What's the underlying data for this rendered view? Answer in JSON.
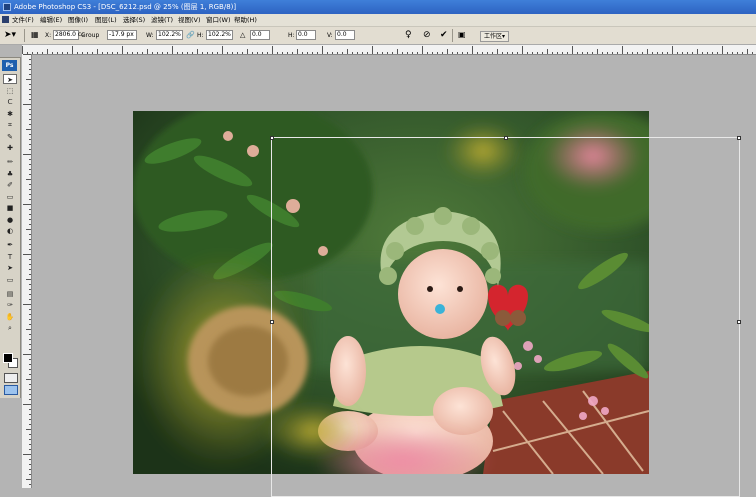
{
  "window": {
    "title": "Adobe Photoshop CS3 - [DSC_6212.psd @ 25% (图层 1, RGB/8)]"
  },
  "menu": [
    "文件(F)",
    "编辑(E)",
    "图像(I)",
    "图层(L)",
    "选择(S)",
    "滤镜(T)",
    "视图(V)",
    "窗口(W)",
    "帮助(H)"
  ],
  "options": {
    "x_label": "X:",
    "x_value": "2806.0 cc",
    "group_label": "Group",
    "y_value": "-17.9 px",
    "w_label": "W:",
    "w_value": "102.2%",
    "h_label": "H:",
    "h_value": "102.2%",
    "rot_value": "0.0",
    "hskew_label": "H:",
    "hskew_value": "0.0",
    "vskew_label": "V:",
    "vskew_value": "0.0",
    "workspace_label": "工作区▾"
  },
  "toolbox": {
    "logo": "Ps",
    "tools": [
      "move-tool",
      "marquee-tool",
      "lasso-tool",
      "magic-wand-tool",
      "crop-tool",
      "slice-tool",
      "healing-brush-tool",
      "brush-tool",
      "clone-stamp-tool",
      "history-brush-tool",
      "eraser-tool",
      "gradient-tool",
      "blur-tool",
      "dodge-tool",
      "pen-tool",
      "type-tool",
      "path-selection-tool",
      "shape-tool",
      "notes-tool",
      "eyedropper-tool",
      "hand-tool",
      "zoom-tool"
    ],
    "tool_glyphs": [
      "➤",
      "⬚",
      "ᑕ",
      "✱",
      "⌗",
      "✎",
      "✚",
      "✏",
      "♣",
      "✐",
      "▭",
      "■",
      "●",
      "◐",
      "✒",
      "T",
      "➤",
      "▭",
      "▤",
      "✑",
      "✋",
      "⌕"
    ]
  },
  "icons": {
    "move": "move-icon",
    "warp": "warp-icon",
    "cancel": "cancel-icon",
    "commit": "commit-icon"
  }
}
